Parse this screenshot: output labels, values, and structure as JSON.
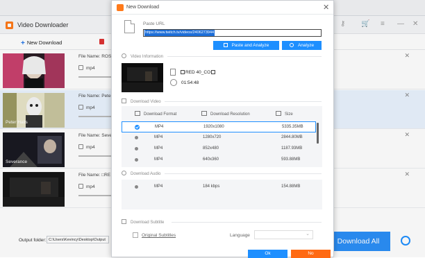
{
  "app": {
    "title": "Video Downloader",
    "toolbar": {
      "new_download": "New Download"
    },
    "items": [
      {
        "file_label": "File Name: ROSÉ",
        "format": "mp4"
      },
      {
        "file_label": "File Name: Peter",
        "format": "mp4",
        "thumb_label": "Peter Halls"
      },
      {
        "file_label": "File Name: Sever",
        "format": "mp4",
        "thumb_label": "Severance"
      },
      {
        "file_label": "File Name: □RE",
        "format": "mp4"
      }
    ],
    "footer": {
      "output_label": "Output folder:",
      "output_path": "C:\\Users\\Kevincy\\Desktop\\Output",
      "download_all": "Download All"
    }
  },
  "dialog": {
    "title": "New Download",
    "paste_url_label": "Paste URL",
    "url_value": "https://www.twitch.tv/videos/2406273944",
    "paste_analyze_label": "Paste and Analyze",
    "analyze_label": "Analyze",
    "video_info": {
      "section_label": "Video Information",
      "name_prefix": "RED 40_CO",
      "duration": "01:54:48"
    },
    "download_video": {
      "section_label": "Download Video",
      "headers": {
        "format": "Download Format",
        "resolution": "Download Resolution",
        "size": "Size"
      },
      "rows": [
        {
          "format": "MP4",
          "resolution": "1920x1080",
          "size": "5335.35MB",
          "selected": true
        },
        {
          "format": "MP4",
          "resolution": "1280x720",
          "size": "2844.80MB",
          "selected": false
        },
        {
          "format": "MP4",
          "resolution": "852x480",
          "size": "1187.93MB",
          "selected": false
        },
        {
          "format": "MP4",
          "resolution": "640x360",
          "size": "593.88MB",
          "selected": false
        }
      ]
    },
    "download_audio": {
      "section_label": "Download Audio",
      "row": {
        "format": "MP4",
        "bitrate": "184 kbps",
        "size": "154.88MB"
      }
    },
    "download_subtitle": {
      "section_label": "Download Subtitle",
      "original_subtitles": "Original Subtitles",
      "language_label": "Language"
    },
    "ok_label": "Ok",
    "no_label": "No"
  },
  "colors": {
    "accent": "#1e8fff",
    "brand_orange": "#ff7a1a",
    "no_button": "#ff6a13"
  }
}
